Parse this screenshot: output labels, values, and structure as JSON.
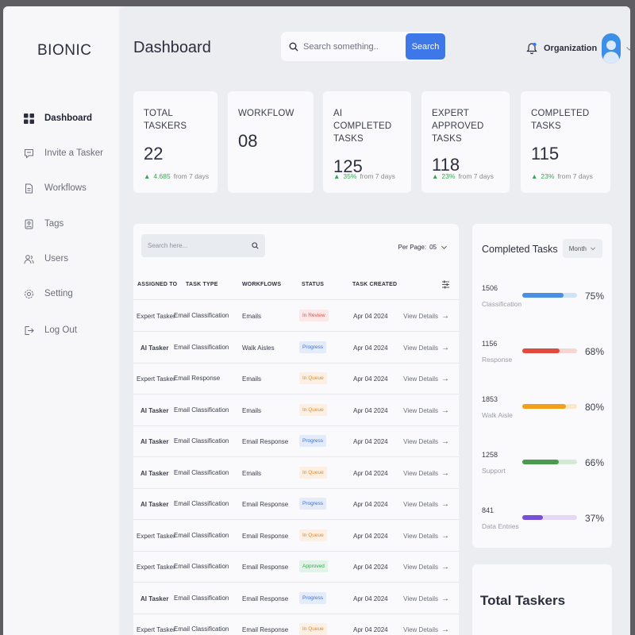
{
  "app": {
    "logo": "BIONIC"
  },
  "sidebar": {
    "items": [
      {
        "label": "Dashboard",
        "icon": "grid-icon",
        "active": true
      },
      {
        "label": "Invite a Tasker",
        "icon": "chat-icon",
        "active": false
      },
      {
        "label": "Workflows",
        "icon": "document-icon",
        "active": false
      },
      {
        "label": "Tags",
        "icon": "tag-icon",
        "active": false
      },
      {
        "label": "Users",
        "icon": "users-icon",
        "active": false
      },
      {
        "label": "Setting",
        "icon": "gear-icon",
        "active": false
      },
      {
        "label": "Log Out",
        "icon": "logout-icon",
        "active": false
      }
    ]
  },
  "header": {
    "title": "Dashboard",
    "search_placeholder": "Search something..",
    "search_button": "Search",
    "org_label": "Organization"
  },
  "stats": [
    {
      "label": "TOTAL TASKERS",
      "value": "22",
      "trend": "4.685",
      "trend_suffix": "from 7 days"
    },
    {
      "label": "WORKFLOW",
      "value": "08"
    },
    {
      "label": "AI COMPLETED TASKS",
      "value": "125",
      "trend": "35%",
      "trend_suffix": "from 7 days"
    },
    {
      "label": "EXPERT APPROVED TASKS",
      "value": "118",
      "trend": "23%",
      "trend_suffix": "from 7 days"
    },
    {
      "label": "COMPLETED TASKS",
      "value": "115",
      "trend": "23%",
      "trend_suffix": "from 7 days"
    }
  ],
  "table": {
    "search_placeholder": "Search here...",
    "per_page_label": "Per Page:",
    "per_page_value": "05",
    "columns": [
      "ASSIGNED TO",
      "TASK TYPE",
      "WORKFLOWS",
      "STATUS",
      "TASK CREATED"
    ],
    "view_label": "View Details",
    "rows": [
      {
        "assigned": "Expert Tasker",
        "type": "Email Classification",
        "workflow": "Emails",
        "status": "In Review",
        "status_kind": "review",
        "created": "Apr 04 2024"
      },
      {
        "assigned": "AI Tasker",
        "type": "Email Classification",
        "workflow": "Walk Aisles",
        "status": "Progress",
        "status_kind": "progress",
        "created": "Apr 04 2024"
      },
      {
        "assigned": "Expert Tasker",
        "type": "Email Response",
        "workflow": "Emails",
        "status": "In Queue",
        "status_kind": "queue",
        "created": "Apr 04 2024"
      },
      {
        "assigned": "AI Tasker",
        "type": "Email Classification",
        "workflow": "Emails",
        "status": "In Queue",
        "status_kind": "queue",
        "created": "Apr 04 2024"
      },
      {
        "assigned": "AI Tasker",
        "type": "Email Classification",
        "workflow": "Email Response",
        "status": "Progress",
        "status_kind": "progress",
        "created": "Apr 04 2024"
      },
      {
        "assigned": "AI Tasker",
        "type": "Email Classification",
        "workflow": "Emails",
        "status": "In Queue",
        "status_kind": "queue",
        "created": "Apr 04 2024"
      },
      {
        "assigned": "AI Tasker",
        "type": "Email Classification",
        "workflow": "Email Response",
        "status": "Progress",
        "status_kind": "progress",
        "created": "Apr 04 2024"
      },
      {
        "assigned": "Expert Tasker",
        "type": "Email Classification",
        "workflow": "Email Response",
        "status": "In Queue",
        "status_kind": "queue",
        "created": "Apr 04 2024"
      },
      {
        "assigned": "Expert Tasker",
        "type": "Email Classification",
        "workflow": "Email Response",
        "status": "Approved",
        "status_kind": "approved",
        "created": "Apr 04 2024"
      },
      {
        "assigned": "AI Tasker",
        "type": "Email Classification",
        "workflow": "Email Response",
        "status": "Progress",
        "status_kind": "progress",
        "created": "Apr 04 2024"
      },
      {
        "assigned": "Expert Tasker",
        "type": "Email Classification",
        "workflow": "Email Response",
        "status": "In Queue",
        "status_kind": "queue",
        "created": "Apr 04 2024"
      }
    ]
  },
  "completed_tasks": {
    "title": "Completed Tasks",
    "filter": "Month",
    "items": [
      {
        "count": "1506",
        "name": "Classification",
        "percent": 75,
        "percent_label": "75%",
        "color": "#4a90e2",
        "track": "#cfe2f7"
      },
      {
        "count": "1156",
        "name": "Response",
        "percent": 68,
        "percent_label": "68%",
        "color": "#e04a3f",
        "track": "#f6d6d3"
      },
      {
        "count": "1853",
        "name": "Walk Aisle",
        "percent": 80,
        "percent_label": "80%",
        "color": "#f0a01a",
        "track": "#fae9c8"
      },
      {
        "count": "1258",
        "name": "Support",
        "percent": 66,
        "percent_label": "66%",
        "color": "#4c9a4f",
        "track": "#d6e9d7"
      },
      {
        "count": "841",
        "name": "Data Entries",
        "percent": 37,
        "percent_label": "37%",
        "color": "#7a4fd8",
        "track": "#e3d9f6"
      }
    ]
  },
  "total_taskers": {
    "title": "Total Taskers"
  }
}
